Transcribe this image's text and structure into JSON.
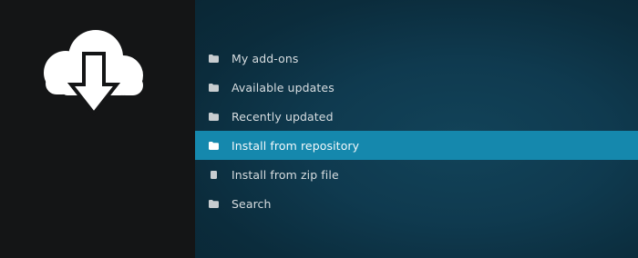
{
  "sidebar": {
    "icon": "cloud-download-icon"
  },
  "menu": {
    "items": [
      {
        "label": "My add-ons",
        "icon": "folder-icon"
      },
      {
        "label": "Available updates",
        "icon": "folder-icon"
      },
      {
        "label": "Recently updated",
        "icon": "folder-icon"
      },
      {
        "label": "Install from repository",
        "icon": "folder-icon",
        "selected": true
      },
      {
        "label": "Install from zip file",
        "icon": "file-icon"
      },
      {
        "label": "Search",
        "icon": "folder-icon"
      }
    ]
  },
  "colors": {
    "sidebar": "#141516",
    "background": "#0b2a38",
    "selection": "#1588ad",
    "text": "#d7dde0"
  }
}
